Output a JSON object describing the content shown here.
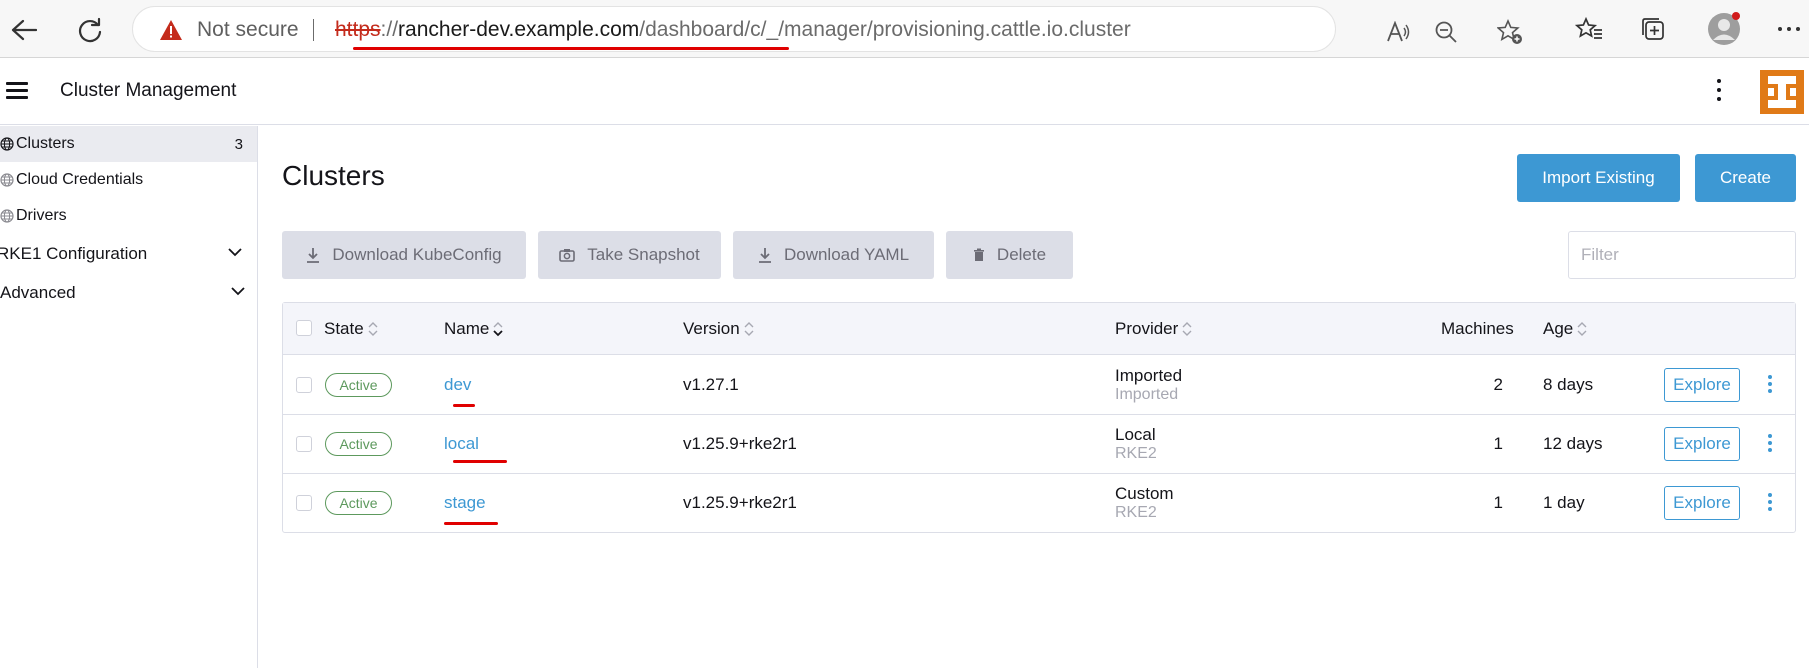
{
  "browser": {
    "security_label": "Not secure",
    "url_scheme": "https",
    "url_sep": "://",
    "url_host": "rancher-dev.example.com",
    "url_path": "/dashboard/c/_/manager/provisioning.cattle.io.cluster"
  },
  "header": {
    "title": "Cluster Management"
  },
  "sidebar": {
    "items": [
      {
        "label": "Clusters",
        "count": "3",
        "icon": "globe-icon",
        "active": true
      },
      {
        "label": "Cloud Credentials",
        "icon": "globe-icon"
      },
      {
        "label": "Drivers",
        "icon": "globe-icon"
      }
    ],
    "groups": [
      {
        "label": "RKE1 Configuration"
      },
      {
        "label": "Advanced"
      }
    ]
  },
  "main": {
    "title": "Clusters",
    "actions": {
      "import": "Import Existing",
      "create": "Create"
    },
    "bulk": {
      "download_kubeconfig": "Download KubeConfig",
      "take_snapshot": "Take Snapshot",
      "download_yaml": "Download YAML",
      "delete": "Delete"
    },
    "filter_placeholder": "Filter",
    "table": {
      "columns": {
        "state": "State",
        "name": "Name",
        "version": "Version",
        "provider": "Provider",
        "machines": "Machines",
        "age": "Age"
      },
      "rows": [
        {
          "state": "Active",
          "name": "dev",
          "version": "v1.27.1",
          "provider": "Imported",
          "provider_sub": "Imported",
          "machines": "2",
          "age": "8 days",
          "action": "Explore"
        },
        {
          "state": "Active",
          "name": "local",
          "version": "v1.25.9+rke2r1",
          "provider": "Local",
          "provider_sub": "RKE2",
          "machines": "1",
          "age": "12 days",
          "action": "Explore"
        },
        {
          "state": "Active",
          "name": "stage",
          "version": "v1.25.9+rke2r1",
          "provider": "Custom",
          "provider_sub": "RKE2",
          "machines": "1",
          "age": "1 day",
          "action": "Explore"
        }
      ]
    }
  },
  "colors": {
    "primary": "#3d98d3",
    "active_green": "#5d995d",
    "annotation_red": "#e00000",
    "logo_orange": "#e07a17"
  }
}
